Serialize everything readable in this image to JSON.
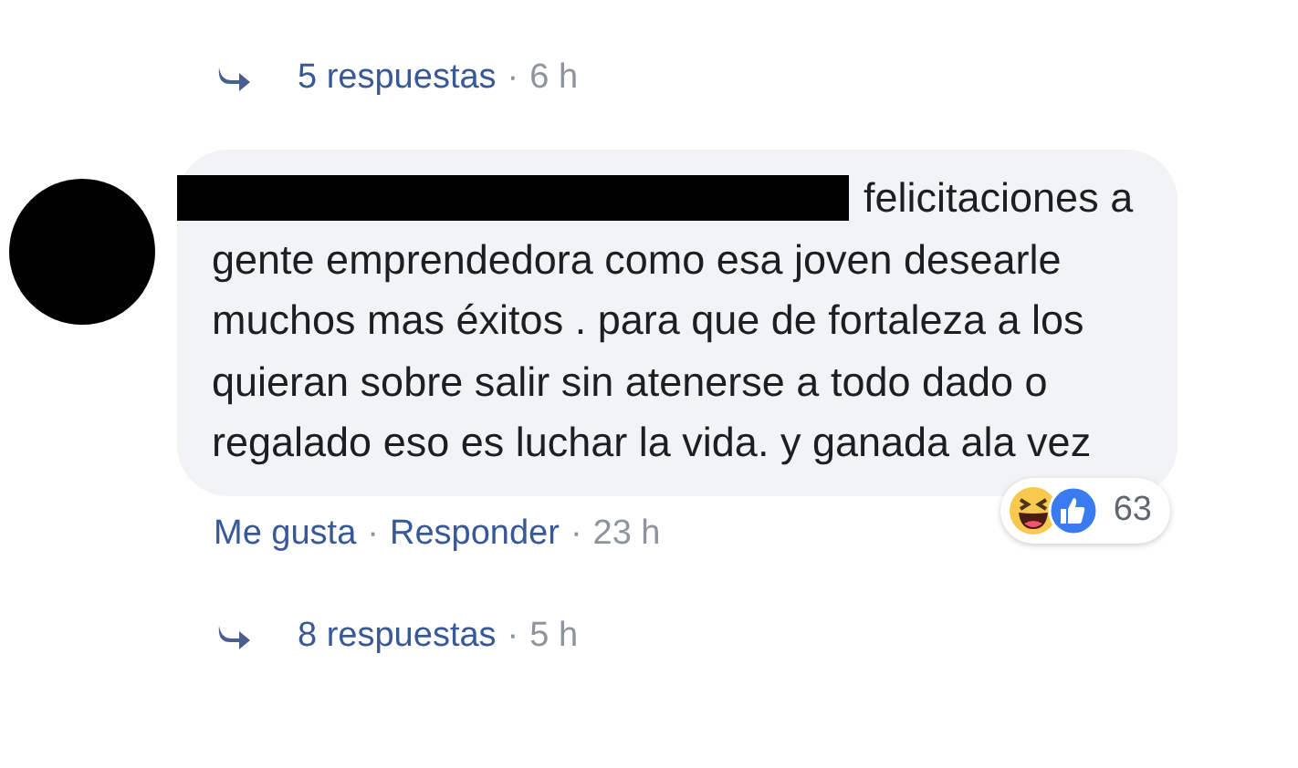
{
  "replies_top": {
    "count": "5 respuestas",
    "separator": "·",
    "time": "6 h"
  },
  "comment": {
    "author": {
      "kind": "redacted"
    },
    "text": "felicitaciones a gente emprendedora como esa joven desearle muchos mas éxitos . para que de fortaleza a los quieran sobre salir sin atenerse a todo dado o regalado eso es luchar la vida. y ganada ala vez",
    "reactions": [
      {
        "kind": "haha"
      },
      {
        "kind": "like"
      }
    ],
    "reaction_count": "63",
    "actions": [
      {
        "label": "Me gusta"
      },
      {
        "separator": "·",
        "label": "Responder"
      }
    ],
    "time_separator": "·",
    "time": "23 h"
  },
  "replies_bottom": {
    "count": "8 respuestas",
    "separator": "·",
    "time": "5 h"
  }
}
